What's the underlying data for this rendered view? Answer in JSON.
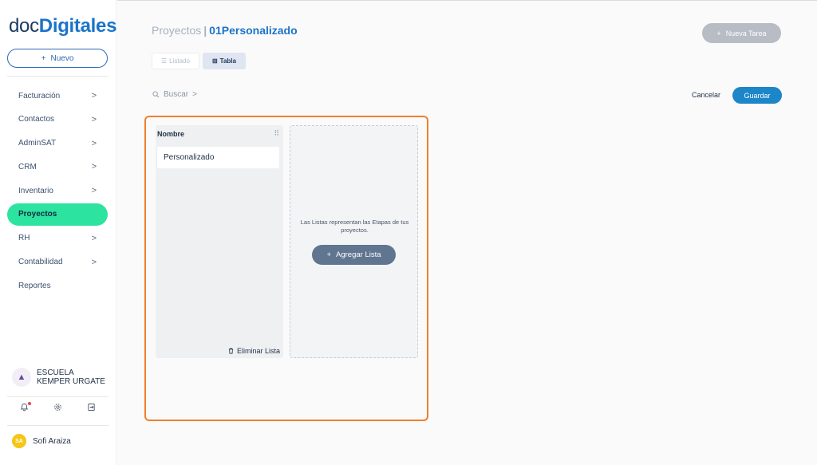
{
  "brand": {
    "part1": "doc",
    "part2": "Digitales"
  },
  "sidebar": {
    "new_label": "Nuevo",
    "items": [
      {
        "label": "Facturación",
        "chevron": true
      },
      {
        "label": "Contactos",
        "chevron": true
      },
      {
        "label": "AdminSAT",
        "chevron": true
      },
      {
        "label": "CRM",
        "chevron": true
      },
      {
        "label": "Inventario",
        "chevron": true
      },
      {
        "label": "Proyectos",
        "chevron": false,
        "active": true
      },
      {
        "label": "RH",
        "chevron": true
      },
      {
        "label": "Contabilidad",
        "chevron": true
      },
      {
        "label": "Reportes",
        "chevron": false
      }
    ],
    "org_name": "ESCUELA KEMPER URGATE",
    "user_initials": "SA",
    "user_name": "Sofi Araiza"
  },
  "header": {
    "section": "Proyectos",
    "separator": "|",
    "project": "01Personalizado",
    "new_task_label": "Nueva Tarea"
  },
  "views": {
    "list_label": "Listado",
    "table_label": "Tabla"
  },
  "search": {
    "label": "Buscar"
  },
  "actions": {
    "cancel_label": "Cancelar",
    "save_label": "Guardar"
  },
  "board": {
    "list_title": "Nombre",
    "card_text": "Personalizado",
    "delete_label": "Eliminar Lista",
    "add_description": "Las Listas representan las Etapas de tus proyectos.",
    "add_button_label": "Agregar Lista"
  },
  "colors": {
    "accent": "#1c74c9",
    "active_nav": "#2de3a0",
    "highlight": "#f07f2a",
    "save": "#1c86c9"
  }
}
